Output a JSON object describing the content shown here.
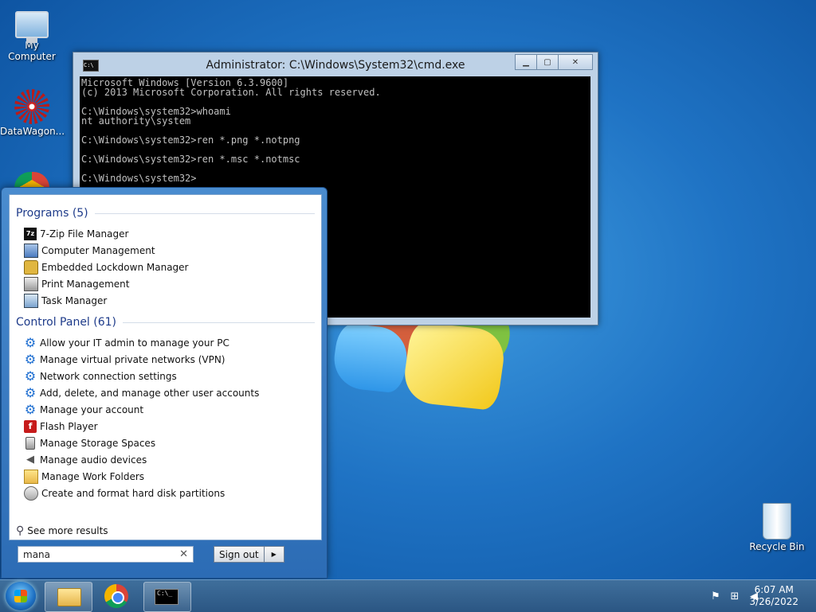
{
  "desktop": {
    "icons": [
      {
        "label": "My Computer"
      },
      {
        "label": "DataWagon..."
      },
      {
        "label": "Recycle Bin"
      }
    ]
  },
  "cmd_window": {
    "title": "Administrator: C:\\Windows\\System32\\cmd.exe",
    "icon_text": "C:\\",
    "output": "Microsoft Windows [Version 6.3.9600]\n(c) 2013 Microsoft Corporation. All rights reserved.\n\nC:\\Windows\\system32>whoami\nnt authority\\system\n\nC:\\Windows\\system32>ren *.png *.notpng\n\nC:\\Windows\\system32>ren *.msc *.notmsc\n\nC:\\Windows\\system32>"
  },
  "start_menu": {
    "programs_header": "Programs (5)",
    "programs": [
      {
        "label": "7-Zip File Manager",
        "icon": "7zip-icon"
      },
      {
        "label": "Computer Management",
        "icon": "computer-management-icon"
      },
      {
        "label": "Embedded Lockdown Manager",
        "icon": "lock-icon"
      },
      {
        "label": "Print Management",
        "icon": "printer-icon"
      },
      {
        "label": "Task Manager",
        "icon": "task-manager-icon"
      }
    ],
    "control_panel_header": "Control Panel (61)",
    "control_panel": [
      {
        "label": "Allow your IT admin to manage your PC",
        "icon": "gear-icon"
      },
      {
        "label": "Manage virtual private networks (VPN)",
        "icon": "gear-icon"
      },
      {
        "label": "Network connection settings",
        "icon": "gear-icon"
      },
      {
        "label": "Add, delete, and manage other user accounts",
        "icon": "gear-icon"
      },
      {
        "label": "Manage your account",
        "icon": "gear-icon"
      },
      {
        "label": "Flash Player",
        "icon": "flash-icon"
      },
      {
        "label": "Manage Storage Spaces",
        "icon": "storage-icon"
      },
      {
        "label": "Manage audio devices",
        "icon": "speaker-icon"
      },
      {
        "label": "Manage Work Folders",
        "icon": "folder-icon"
      },
      {
        "label": "Create and format hard disk partitions",
        "icon": "disk-icon"
      }
    ],
    "see_more": "See more results",
    "search_value": "mana",
    "sign_out": "Sign out"
  },
  "taskbar": {
    "clock_time": "6:07 AM",
    "clock_date": "3/26/2022"
  }
}
